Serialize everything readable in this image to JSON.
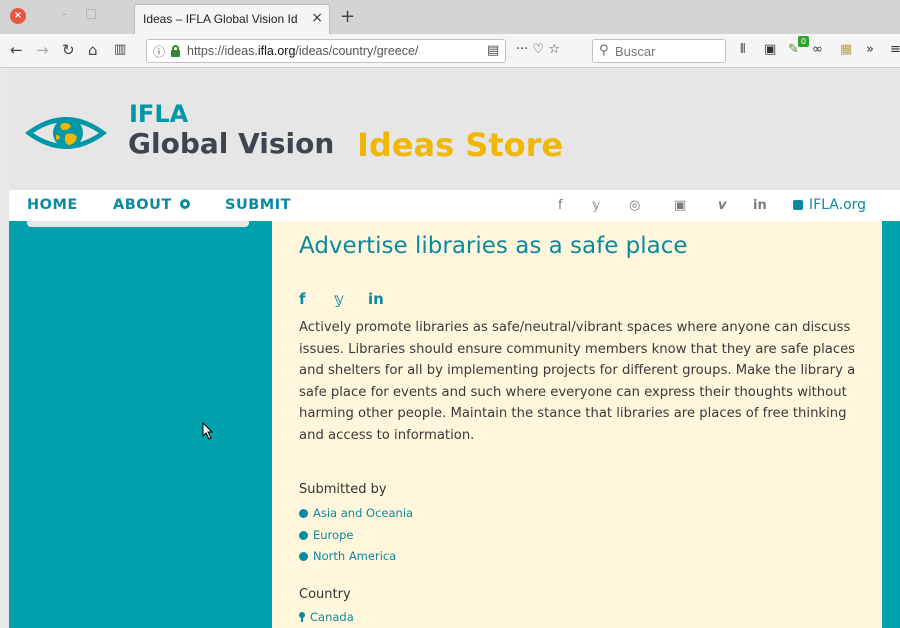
{
  "browser": {
    "tab_title": "Ideas – IFLA Global Vision Id",
    "close_glyph": "×",
    "new_tab_glyph": "+",
    "url_prefix": "https://ideas.",
    "url_domain": "ifla.org",
    "url_suffix": "/ideas/country/greece/",
    "search_placeholder": "Buscar",
    "badge_count": "0"
  },
  "header": {
    "logo_ifla": "IFLA",
    "logo_global_vision": "Global Vision",
    "logo_ideas_store": "Ideas Store"
  },
  "menu": {
    "home": "HOME",
    "about": "ABOUT",
    "submit": "SUBMIT",
    "social": [
      "f",
      "𝕪",
      "◎",
      "▣",
      "v",
      "in"
    ],
    "ifla_link": "IFLA.org"
  },
  "article": {
    "title": "Advertise libraries as a safe place",
    "share": [
      "f",
      "𝕪",
      "in"
    ],
    "description": "Actively promote libraries as safe/neutral/vibrant spaces where anyone can discuss issues. Libraries should ensure community members know that they are safe places and shelters for all by implementing projects for different groups. Make the library a safe place for events and such where everyone can express their thoughts without harming other people. Maintain the stance that libraries are places of free thinking and access to information.",
    "submitted_by_label": "Submitted by",
    "regions": [
      "Asia and Oceania",
      "Europe",
      "North America"
    ],
    "country_label": "Country",
    "countries": [
      "Canada"
    ]
  },
  "colors": {
    "teal": "#00a0ad",
    "link": "#0a8aa0",
    "yellow": "#f2b705",
    "content_bg": "#fff6dc"
  }
}
